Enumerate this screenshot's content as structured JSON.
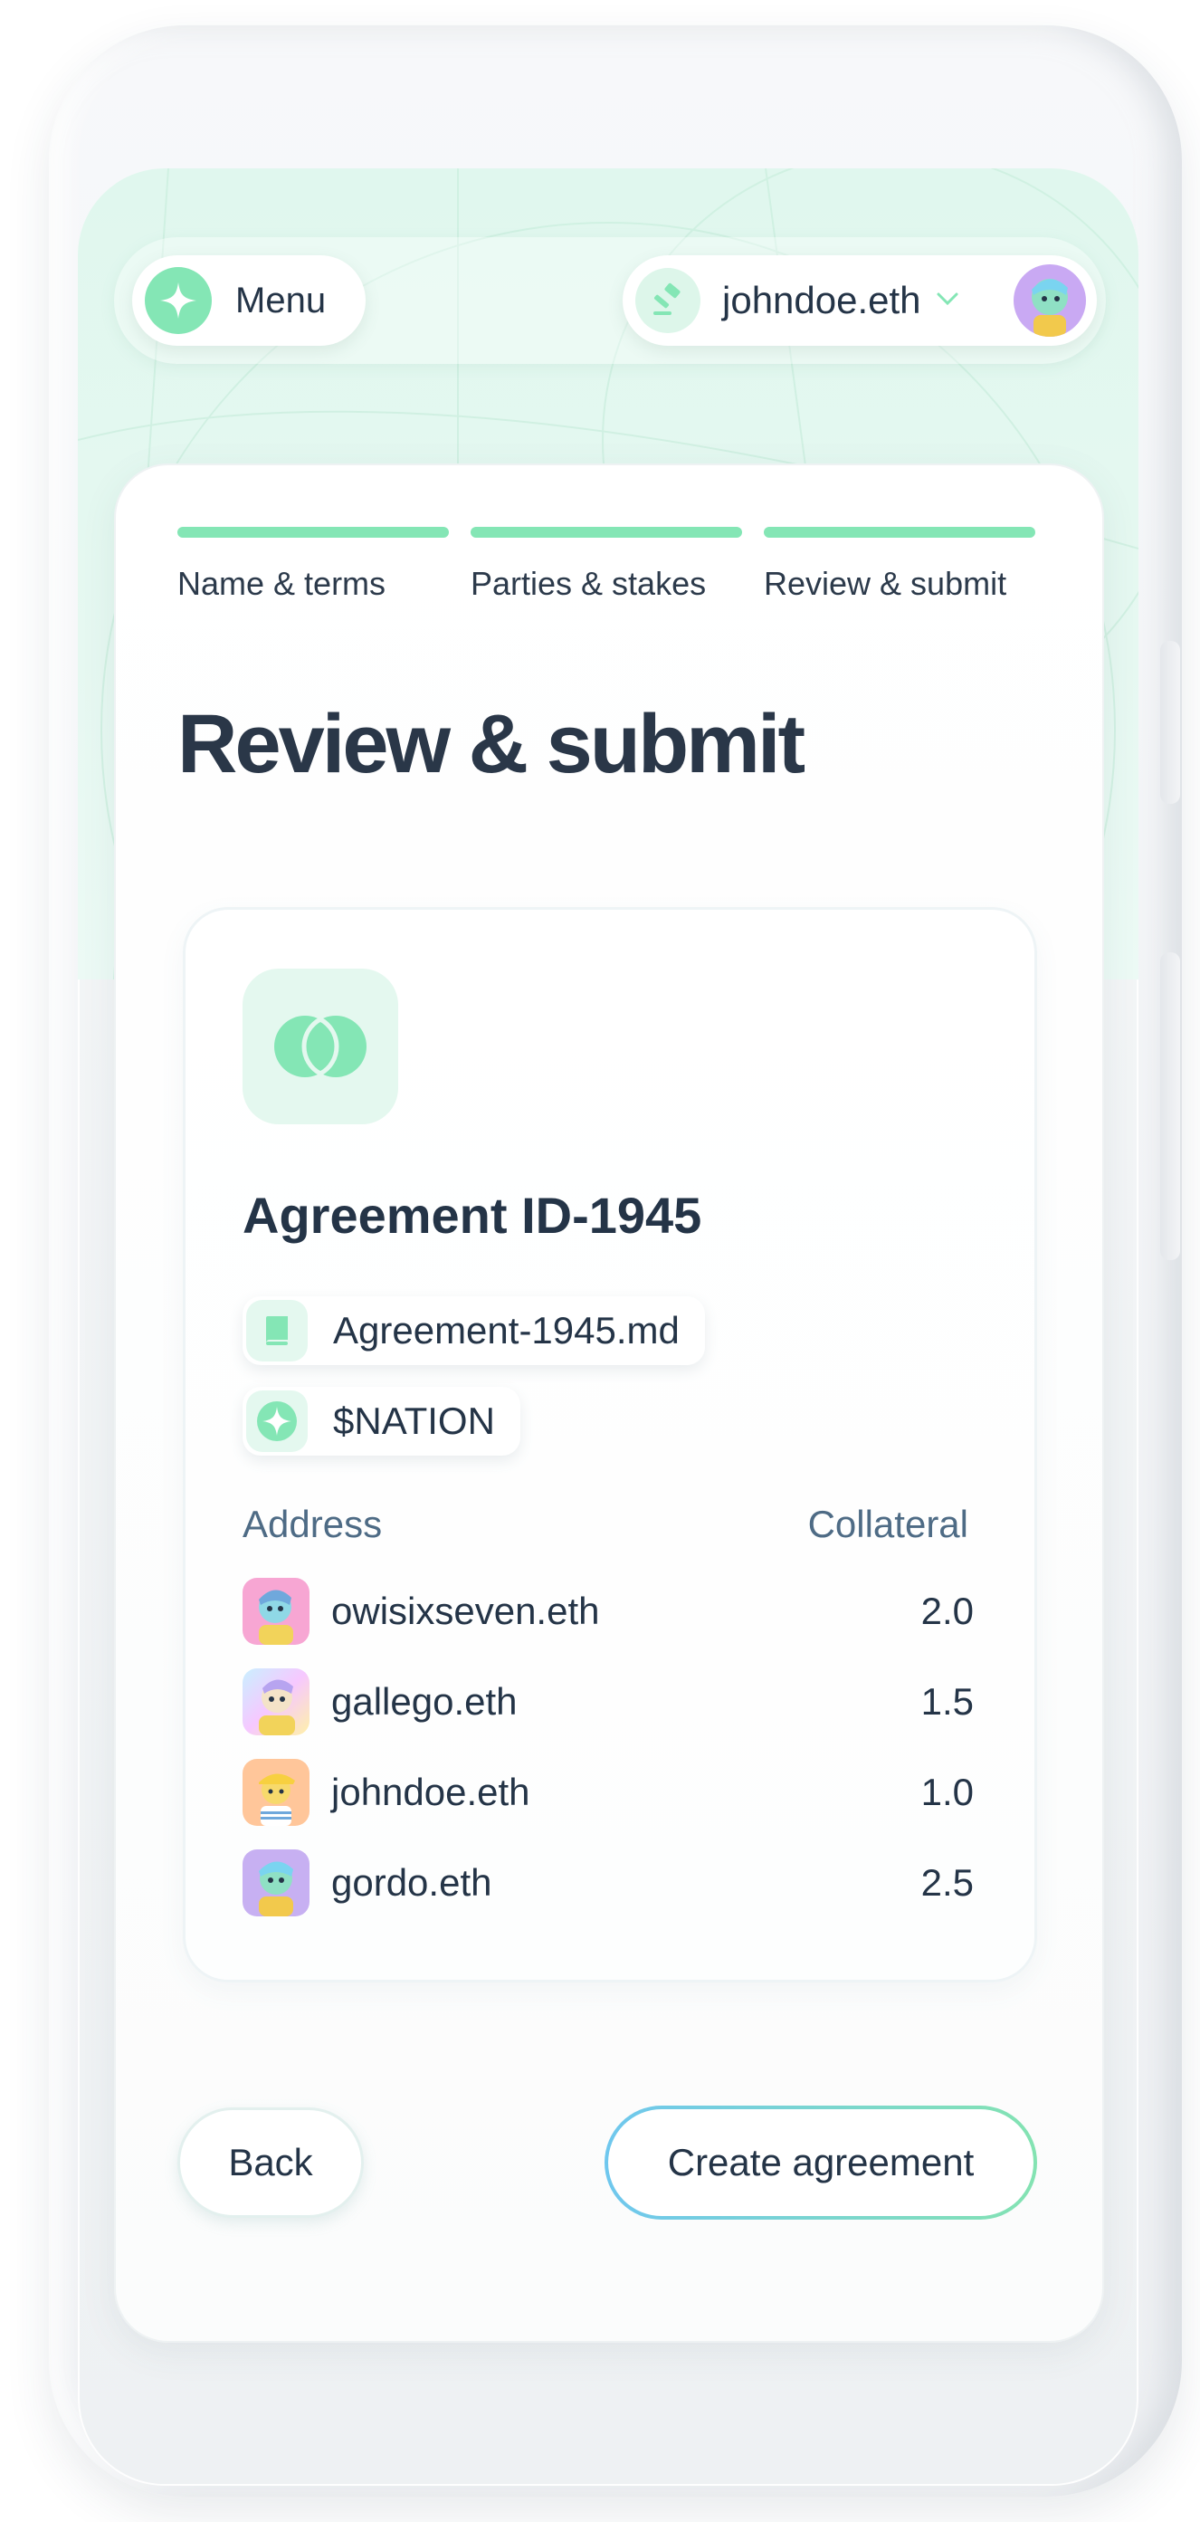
{
  "header": {
    "menu_label": "Menu",
    "user_name": "johndoe.eth"
  },
  "steps": [
    {
      "label": "Name & terms",
      "complete": true
    },
    {
      "label": "Parties & stakes",
      "complete": true
    },
    {
      "label": "Review & submit",
      "complete": true
    }
  ],
  "page_title": "Review & submit",
  "agreement": {
    "title": "Agreement ID-1945",
    "file": "Agreement-1945.md",
    "token": "$NATION"
  },
  "table": {
    "col_address": "Address",
    "col_collateral": "Collateral",
    "rows": [
      {
        "address": "owisixseven.eth",
        "collateral": "2.0",
        "avatar_color": "#f7a6d3"
      },
      {
        "address": "gallego.eth",
        "collateral": "1.5",
        "avatar_color": "#f4d2ff"
      },
      {
        "address": "johndoe.eth",
        "collateral": "1.0",
        "avatar_color": "#ffc69a"
      },
      {
        "address": "gordo.eth",
        "collateral": "2.5",
        "avatar_color": "#c7b0f2"
      }
    ]
  },
  "actions": {
    "back": "Back",
    "create": "Create agreement"
  },
  "colors": {
    "accent_mint": "#84e6b5",
    "gradient_blue": "#6fc7ee",
    "text_dark": "#243447",
    "text_muted": "#4e6b85"
  }
}
